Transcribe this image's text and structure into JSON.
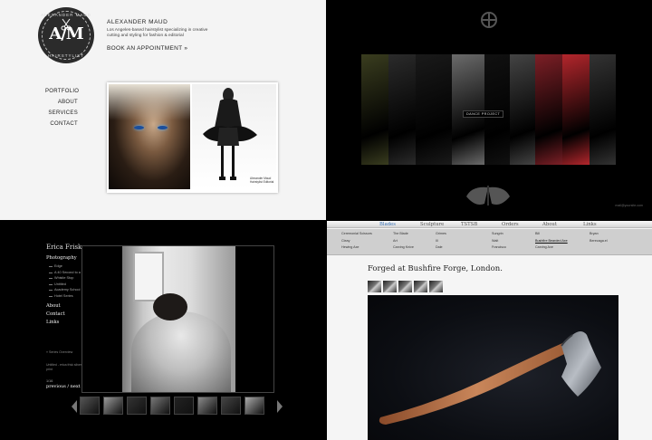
{
  "q1": {
    "logo": {
      "top": "ALEXANDER MAUD",
      "mono": "A/M",
      "bottom": "HAIRSTYLIST"
    },
    "name": "ALEXANDER MAUD",
    "description": "Los Angeles-based hairstylist specializing in creative cutting and styling for fashion & editorial",
    "book_label": "BOOK AN APPOINTMENT »",
    "nav": [
      "PORTFOLIO",
      "ABOUT",
      "SERVICES",
      "CONTACT"
    ],
    "caption": "Alexander Maud Hairstylist Editorial"
  },
  "q2": {
    "label": "DANCE PROJECT",
    "footer": "mail@yoursite.com",
    "panel_colors": [
      "#3a3d1f",
      "#2b2b2b",
      "#1a1a1a",
      "#6b6b6b",
      "#111111",
      "#444444",
      "#7d1f26",
      "#b3262c",
      "#333333"
    ]
  },
  "q3": {
    "name": "Erica Frisk",
    "nav_main": "Photography",
    "nav_sub": [
      "Edge",
      "A 40 Second to a Sensible Difference",
      "Whistle Stop",
      "Untitled",
      "Academy School",
      "Hotel Series"
    ],
    "nav_after": [
      "About",
      "Contact",
      "Links"
    ],
    "back": "« Series Overview",
    "info": "Untitled - erica frisk silver print",
    "count": "1/16",
    "prevnext": "previous / next"
  },
  "q4": {
    "tabs": [
      "Blades",
      "Sculpture",
      "TSTSB",
      "Orders",
      "About",
      "Links"
    ],
    "active_tab": "Blades",
    "menu_cols": [
      [
        "Ceremonial Scissors",
        "Cleay",
        "Hewing Axe"
      ],
      [
        "The Blade",
        "Art",
        "Carving Knive"
      ],
      [
        "Grimes",
        "Ill",
        "Dale"
      ],
      [
        "Sungrin",
        "Walt",
        "Francisco"
      ],
      [
        "Bill",
        "Bushfire Bearded Axe",
        "Carving Axe"
      ],
      [
        "Bryan",
        "Berecaga.el"
      ]
    ],
    "highlight": "Bushfire Bearded Axe",
    "title": "Forged at Bushfire Forge, London."
  }
}
